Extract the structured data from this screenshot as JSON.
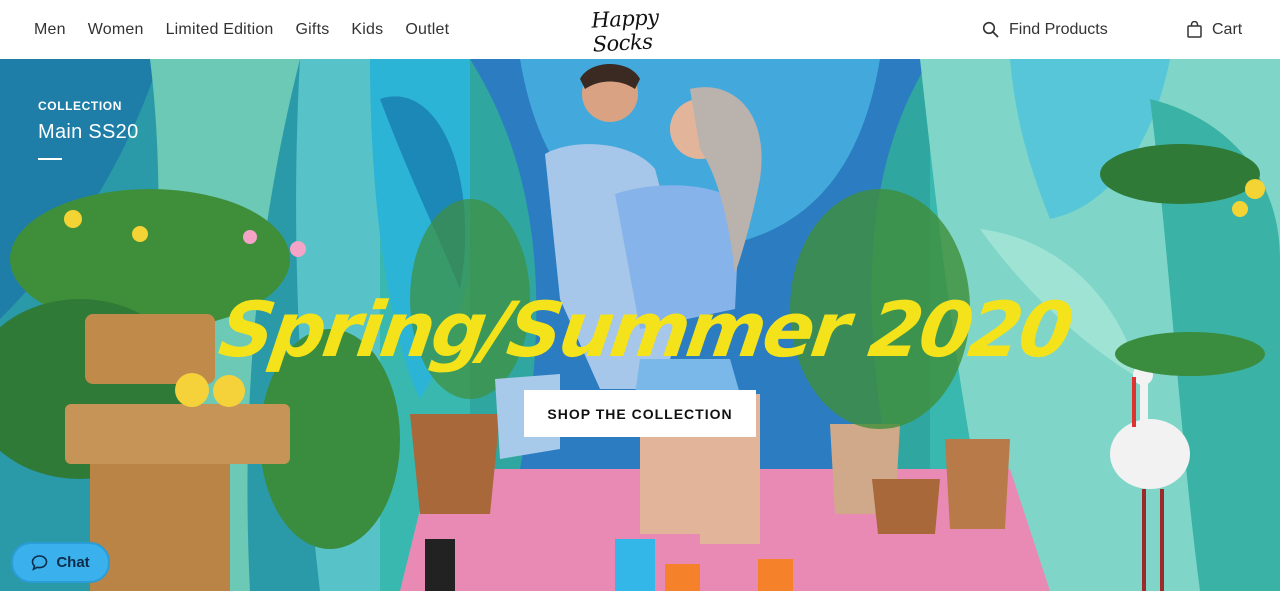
{
  "header": {
    "nav": [
      "Men",
      "Women",
      "Limited Edition",
      "Gifts",
      "Kids",
      "Outlet"
    ],
    "logo_text": "Happy Socks",
    "search_label": "Find Products",
    "cart_label": "Cart"
  },
  "hero": {
    "kicker": "COLLECTION",
    "collection_name": "Main SS20",
    "headline": "Spring/Summer 2020",
    "cta_label": "SHOP THE COLLECTION",
    "headline_color": "#f4e21a",
    "floor_color": "#e88ab4"
  },
  "chat": {
    "label": "Chat",
    "color": "#3ab0ec"
  },
  "icons": [
    "search-icon",
    "cart-icon",
    "chat-icon"
  ]
}
